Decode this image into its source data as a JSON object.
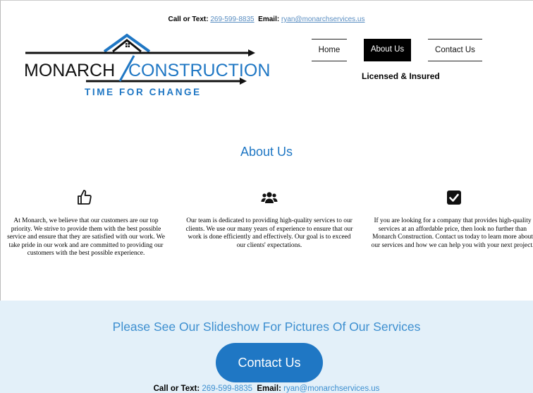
{
  "header": {
    "call_label": "Call or Text:",
    "phone": "269-599-8835",
    "email_label": "Email:",
    "email": "ryan@monarchservices.us"
  },
  "logo": {
    "word1": "MONARCH",
    "word2": "CONSTRUCTION",
    "tagline": "TIME FOR CHANGE",
    "colors": {
      "dark": "#111111",
      "blue": "#1f77c4"
    }
  },
  "nav": {
    "home": "Home",
    "about": "About Us",
    "contact": "Contact Us"
  },
  "licensed": "Licensed & Insured",
  "about": {
    "title": "About Us",
    "columns": [
      {
        "icon": "thumbs-up-icon",
        "text": "At Monarch, we believe that our customers are our top priority. We strive to provide them with the best possible service and ensure that they are satisfied with our work. We take pride in our work and are committed to providing our customers with the best possible experience."
      },
      {
        "icon": "users-icon",
        "text": "Our team is dedicated to providing high-quality services to our clients. We use our many years of experience to ensure that our work is done efficiently and effectively. Our goal is to exceed our clients' expectations."
      },
      {
        "icon": "checkbox-icon",
        "text": "If you are looking for a company that provides high-quality services at an affordable price, then look no further than Monarch Construction. Contact us today to learn more about our services and how we can help you with your next project."
      }
    ]
  },
  "slideshow": {
    "title": "Please See Our Slideshow For Pictures Of Our Services",
    "button": "Contact Us",
    "colors": {
      "band": "#e3f0f9",
      "button": "#1f77c4"
    }
  },
  "footer": {
    "call_label": "Call or Text:",
    "phone": "269-599-8835",
    "email_label": "Email:",
    "email": "ryan@monarchservices.us"
  }
}
